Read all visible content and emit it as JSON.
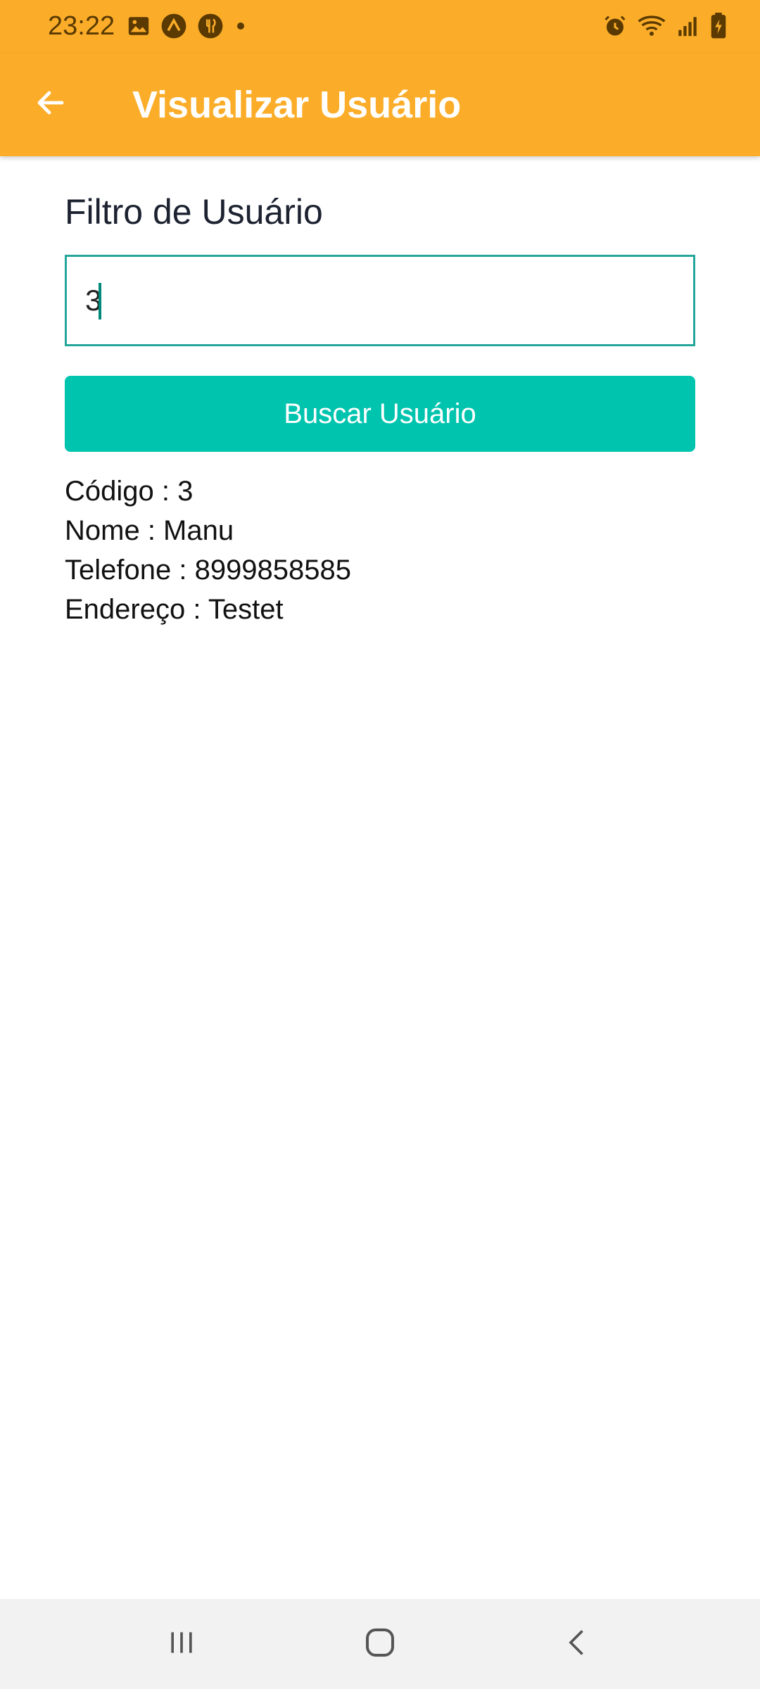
{
  "status_bar": {
    "time": "23:22",
    "left_icons": [
      "image-icon",
      "expo-icon",
      "food-icon",
      "dot-icon"
    ],
    "right_icons": [
      "alarm-icon",
      "wifi-icon",
      "signal-icon",
      "battery-icon"
    ]
  },
  "app_bar": {
    "title": "Visualizar Usuário",
    "back_icon": "arrow-left-icon"
  },
  "filter": {
    "label": "Filtro de Usuário",
    "value": "3",
    "button_label": "Buscar Usuário"
  },
  "result": {
    "codigo": "Código : 3",
    "nome": "Nome : Manu",
    "telefone": "Telefone : 8999858585",
    "endereco": "Endereço : Testet"
  },
  "nav_bar": {
    "icons": [
      "recent-apps-icon",
      "home-icon",
      "back-icon"
    ]
  },
  "colors": {
    "app_bar": "#FBAD2A",
    "button": "#00C4AE",
    "input_border": "#26a69a"
  }
}
